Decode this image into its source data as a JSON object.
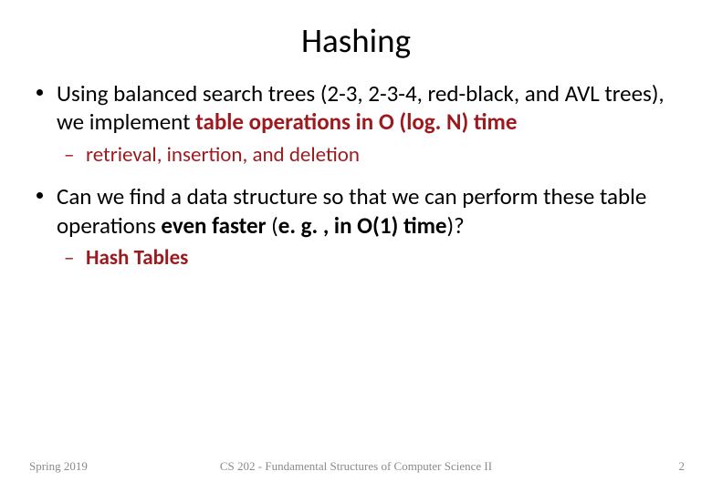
{
  "title": "Hashing",
  "bullets": [
    {
      "level": 1,
      "runs": [
        {
          "text": "Using balanced search trees (2-3, 2-3-4, red-black, and AVL trees), we implement ",
          "cls": ""
        },
        {
          "text": "table operations in O (log. N) time",
          "cls": "bold dark-red"
        }
      ]
    },
    {
      "level": 2,
      "runs": [
        {
          "text": "retrieval, insertion, and deletion",
          "cls": "dark-red"
        }
      ]
    },
    {
      "level": 1,
      "runs": [
        {
          "text": "Can we find a data structure so that we can perform these table operations ",
          "cls": ""
        },
        {
          "text": "even faster ",
          "cls": "bold"
        },
        {
          "text": "(",
          "cls": ""
        },
        {
          "text": "e. g. , in O(1) time",
          "cls": "bold"
        },
        {
          "text": ")?",
          "cls": ""
        }
      ]
    },
    {
      "level": 2,
      "runs": [
        {
          "text": "Hash Tables",
          "cls": "bold dark-red"
        }
      ]
    }
  ],
  "footer": {
    "left": "Spring 2019",
    "center": "CS 202 - Fundamental Structures of Computer Science II",
    "right": "2"
  }
}
